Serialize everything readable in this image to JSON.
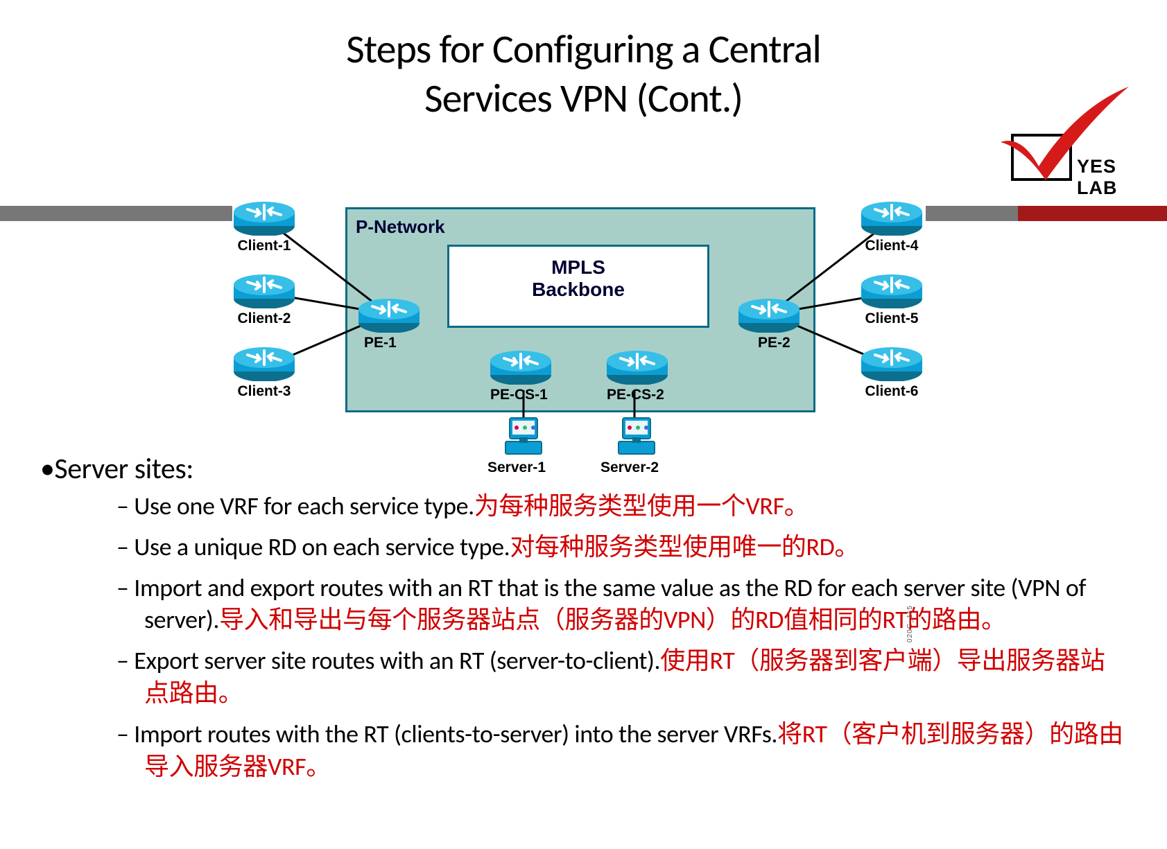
{
  "title_l1": "Steps for Configuring a Central",
  "title_l2": "Services VPN (Cont.)",
  "logo_text": "YES LAB",
  "diagram": {
    "pnet_label": "P-Network",
    "backbone_l1": "MPLS",
    "backbone_l2": "Backbone",
    "devices": {
      "client1": "Client-1",
      "client2": "Client-2",
      "client3": "Client-3",
      "client4": "Client-4",
      "client5": "Client-5",
      "client6": "Client-6",
      "pe1": "PE-1",
      "pe2": "PE-2",
      "pecs1": "PE-CS-1",
      "pecs2": "PE-CS-2",
      "server1": "Server-1",
      "server2": "Server-2"
    }
  },
  "watermark": "020G_115",
  "heading": "Server sites:",
  "items": [
    {
      "en": "Use one VRF for each service type.",
      "zh": "为每种服务类型使用一个VRF。"
    },
    {
      "en": "Use a unique RD on each service type.",
      "zh": "对每种服务类型使用唯一的RD。"
    },
    {
      "en": "Import and export routes with an RT that is the same value as the  RD for each server site (VPN of server).",
      "zh": "导入和导出与每个服务器站点（服务器的VPN）的RD值相同的RT的路由。"
    },
    {
      "en": "Export server site routes with an RT (server-to-client).",
      "zh": "使用RT（服务器到客户端）导出服务器站点路由。"
    },
    {
      "en": "Import routes with the RT (clients-to-server) into the server VRFs.",
      "zh": "将RT（客户机到服务器）的路由导入服务器VRF。"
    }
  ]
}
